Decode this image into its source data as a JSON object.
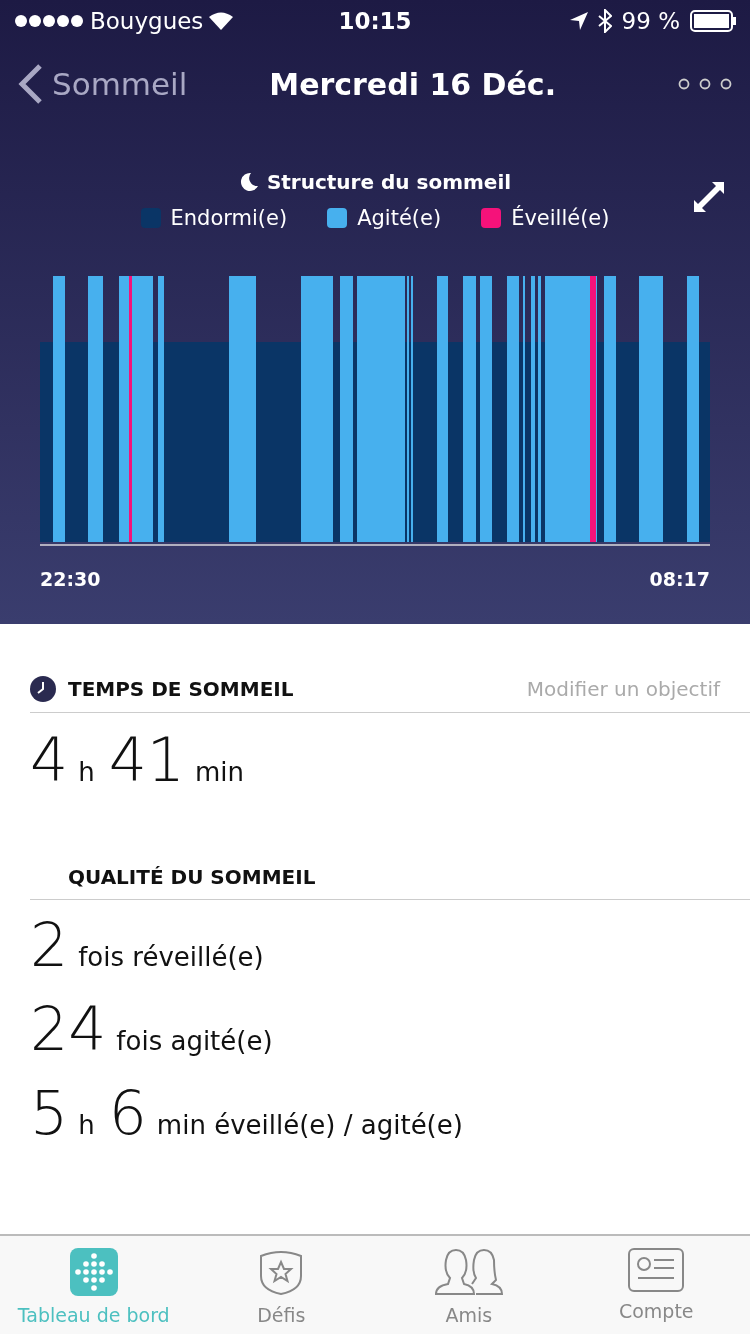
{
  "status_bar": {
    "carrier": "Bouygues",
    "time": "10:15",
    "battery": "99 %"
  },
  "nav": {
    "back": "Sommeil",
    "title": "Mercredi 16 Déc."
  },
  "chart": {
    "title": "Structure du sommeil",
    "legend": [
      {
        "label": "Endormi(e)",
        "color": "#0a3566"
      },
      {
        "label": "Agité(e)",
        "color": "#47b0ee"
      },
      {
        "label": "Éveillé(e)",
        "color": "#f5127a"
      }
    ],
    "start": "22:30",
    "end": "08:17"
  },
  "sleep_time": {
    "heading": "TEMPS DE SOMMEIL",
    "action": "Modifier un objectif",
    "parts": [
      {
        "value": "4",
        "unit": "h"
      },
      {
        "value": "41",
        "unit": "min"
      }
    ]
  },
  "quality": {
    "heading": "QUALITÉ DU SOMMEIL",
    "rows": [
      {
        "parts": [
          {
            "value": "2",
            "unit": "fois réveillé(e)"
          }
        ]
      },
      {
        "parts": [
          {
            "value": "24",
            "unit": "fois agité(e)"
          }
        ]
      },
      {
        "parts": [
          {
            "value": "5",
            "unit": "h"
          },
          {
            "value": "6",
            "unit": "min éveillé(e) / agité(e)"
          }
        ]
      }
    ]
  },
  "tabs": [
    {
      "label": "Tableau de bord",
      "kind": "dashboard",
      "selected": true
    },
    {
      "label": "Défis",
      "kind": "challenges",
      "selected": false
    },
    {
      "label": "Amis",
      "kind": "friends",
      "selected": false
    },
    {
      "label": "Compte",
      "kind": "account",
      "selected": false
    }
  ]
}
